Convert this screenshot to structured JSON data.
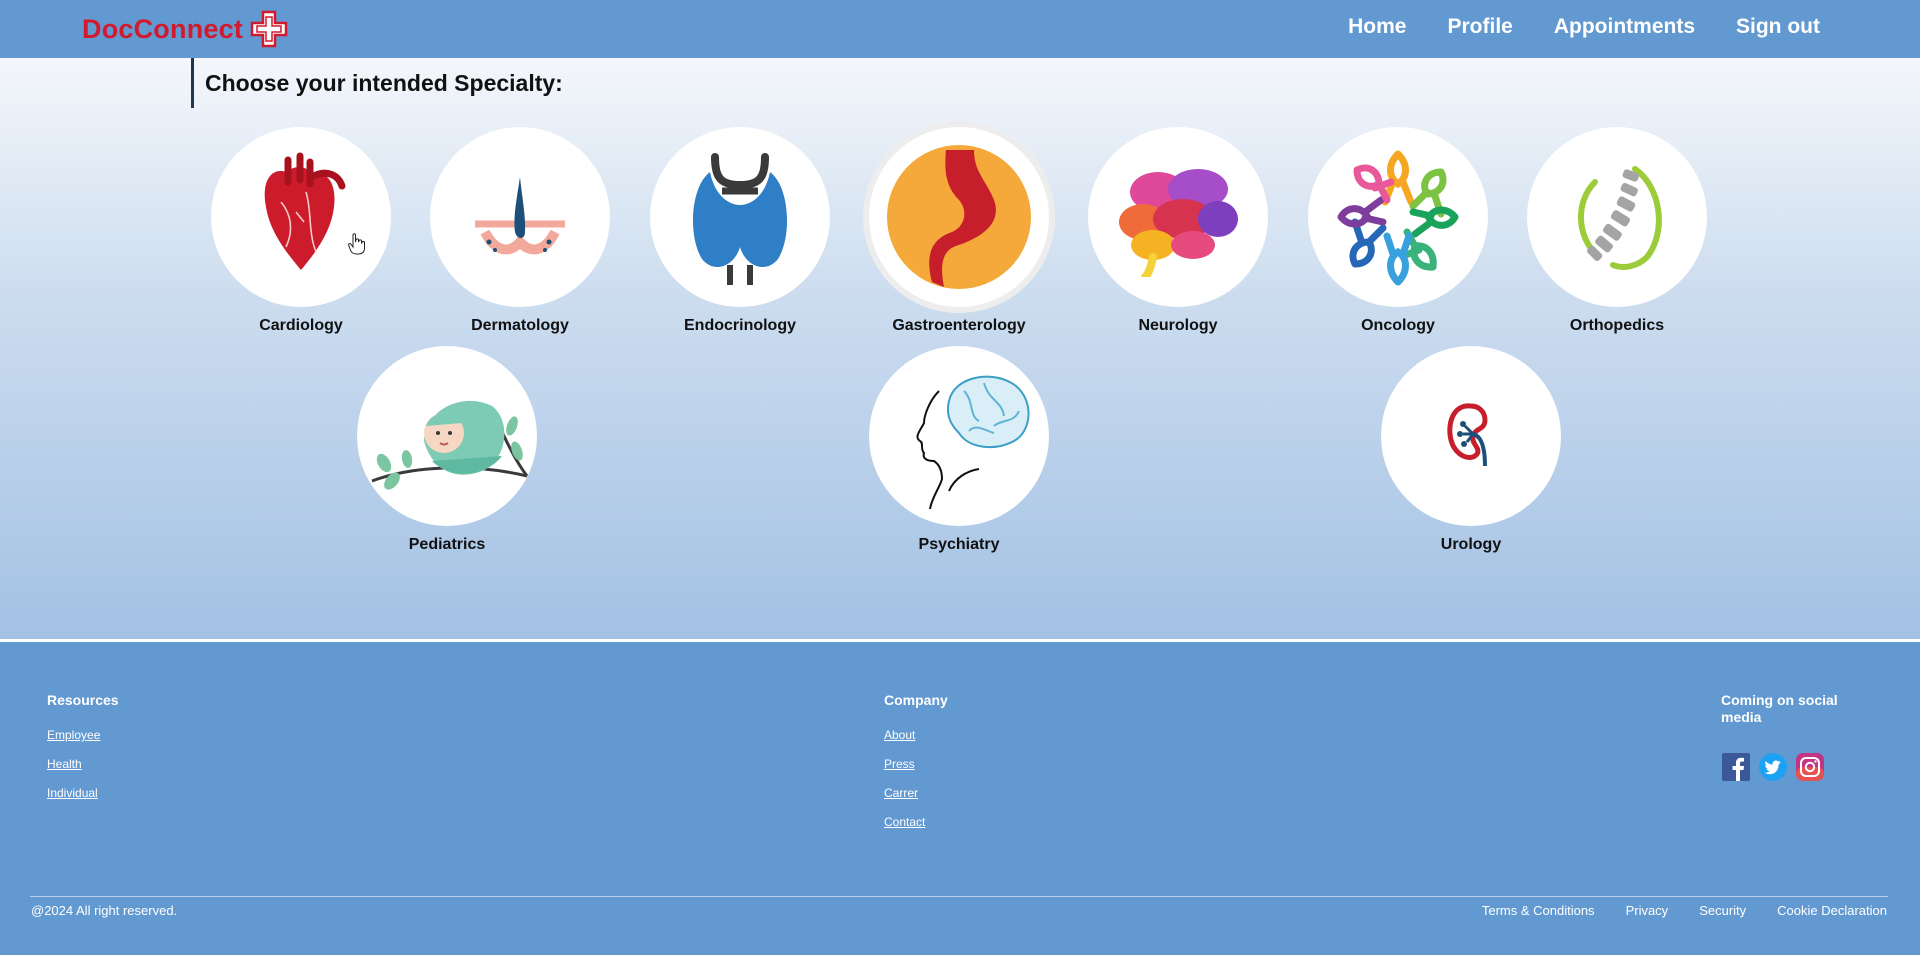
{
  "header": {
    "logo_text": "DocConnect",
    "nav": [
      "Home",
      "Profile",
      "Appointments",
      "Sign out"
    ]
  },
  "main": {
    "heading": "Choose your intended Specialty:",
    "specialties": [
      {
        "label": "Cardiology",
        "icon": "heart-icon"
      },
      {
        "label": "Dermatology",
        "icon": "skin-hair-icon"
      },
      {
        "label": "Endocrinology",
        "icon": "thyroid-icon"
      },
      {
        "label": "Gastroenterology",
        "icon": "stomach-icon"
      },
      {
        "label": "Neurology",
        "icon": "brain-icon"
      },
      {
        "label": "Oncology",
        "icon": "awareness-ribbons-icon"
      },
      {
        "label": "Orthopedics",
        "icon": "spine-icon"
      },
      {
        "label": "Pediatrics",
        "icon": "baby-icon"
      },
      {
        "label": "Psychiatry",
        "icon": "head-brain-icon"
      },
      {
        "label": "Urology",
        "icon": "kidney-icon"
      }
    ]
  },
  "footer": {
    "resources": {
      "title": "Resources",
      "links": [
        "Employee",
        "Health",
        "Individual"
      ]
    },
    "company": {
      "title": "Company",
      "links": [
        "About",
        "Press",
        "Carrer",
        "Contact"
      ]
    },
    "social": {
      "title": "Coming on social media",
      "icons": [
        "facebook-icon",
        "twitter-icon",
        "instagram-icon"
      ]
    },
    "copyright": "@2024 All right reserved.",
    "legal": [
      "Terms & Conditions",
      "Privacy",
      "Security",
      "Cookie Declaration"
    ]
  },
  "colors": {
    "header_bg": "#6399d1",
    "brand_red": "#d21a2e",
    "footer_bg": "#6399d1"
  }
}
